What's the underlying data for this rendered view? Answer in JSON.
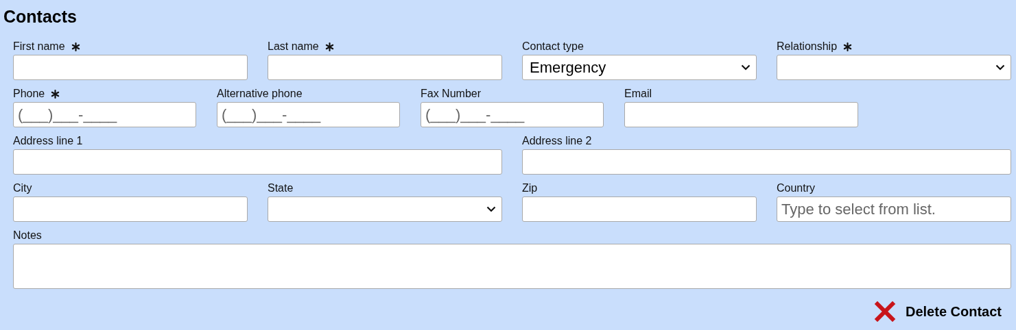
{
  "title": "Contacts",
  "rows": [
    {
      "kind": "quad",
      "fields": [
        {
          "label": "First name",
          "required": true,
          "kind": "text"
        },
        {
          "label": "Last name",
          "required": true,
          "kind": "text"
        },
        {
          "label": "Contact type",
          "required": false,
          "kind": "select",
          "value": "Emergency"
        },
        {
          "label": "Relationship",
          "required": true,
          "kind": "select"
        }
      ]
    },
    {
      "kind": "phones",
      "fields": [
        {
          "label": "Phone",
          "required": true,
          "kind": "text",
          "placeholder": "(___)___-____"
        },
        {
          "label": "Alternative phone",
          "required": false,
          "kind": "text",
          "placeholder": "(___)___-____"
        },
        {
          "label": "Fax Number",
          "required": false,
          "kind": "text",
          "placeholder": "(___)___-____"
        },
        {
          "label": "Email",
          "required": false,
          "kind": "text"
        }
      ]
    },
    {
      "kind": "pair",
      "fields": [
        {
          "label": "Address line 1",
          "required": false,
          "kind": "text"
        },
        {
          "label": "Address line 2",
          "required": false,
          "kind": "text"
        }
      ]
    },
    {
      "kind": "quad",
      "fields": [
        {
          "label": "City",
          "required": false,
          "kind": "text"
        },
        {
          "label": "State",
          "required": false,
          "kind": "select"
        },
        {
          "label": "Zip",
          "required": false,
          "kind": "text"
        },
        {
          "label": "Country",
          "required": false,
          "kind": "text",
          "placeholder": "Type to select from list."
        }
      ]
    },
    {
      "kind": "full",
      "fields": [
        {
          "label": "Notes",
          "required": false,
          "kind": "textarea"
        }
      ]
    }
  ],
  "delete_button": {
    "label": "Delete Contact"
  }
}
